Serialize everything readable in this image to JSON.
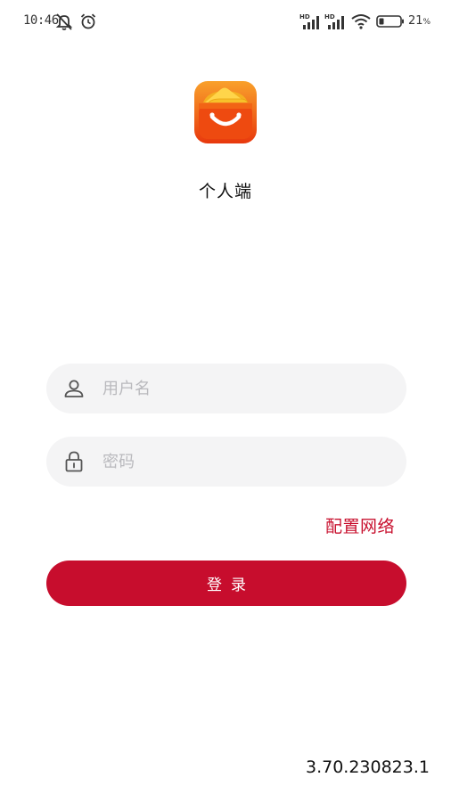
{
  "status_bar": {
    "time": "10:46",
    "battery_percent": "21",
    "battery_unit": "%",
    "network_label_1": "HD",
    "network_label_2": "HD",
    "icons": [
      "muted-notification-icon",
      "alarm-icon",
      "signal-hd-icon",
      "signal-hd-icon",
      "wifi-icon",
      "battery-icon"
    ]
  },
  "app": {
    "title": "个人端",
    "logo_icon": "shopping-basket-logo-icon"
  },
  "form": {
    "username_placeholder": "用户名",
    "username_value": "",
    "password_placeholder": "密码",
    "password_value": "",
    "config_network_label": "配置网络",
    "login_label": "登录"
  },
  "version": "3.70.230823.1",
  "colors": {
    "accent": "#c70d2d",
    "link": "#c8102e",
    "field_bg": "#f4f4f5",
    "logo_orange": "#f04e12",
    "logo_yellow": "#f7c12a"
  }
}
